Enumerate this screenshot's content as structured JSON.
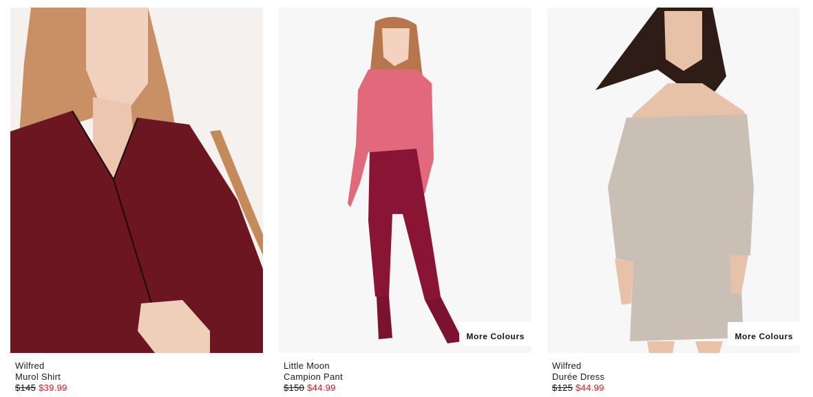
{
  "products": [
    {
      "brand": "Wilfred",
      "name": "Murol Shirt",
      "original_price": "$145",
      "sale_price": "$39.99",
      "more_colours": ""
    },
    {
      "brand": "Little Moon",
      "name": "Campion Pant",
      "original_price": "$150",
      "sale_price": "$44.99",
      "more_colours": "More Colours"
    },
    {
      "brand": "Wilfred",
      "name": "Durée Dress",
      "original_price": "$125",
      "sale_price": "$44.99",
      "more_colours": "More Colours"
    }
  ],
  "colors": {
    "sale_price": "#e4141d",
    "image_background": "#f6f6f6",
    "shirt": "#6b1620",
    "sweater": "#e06a7c",
    "pant": "#8a1434",
    "dress": "#c9bfb4"
  }
}
